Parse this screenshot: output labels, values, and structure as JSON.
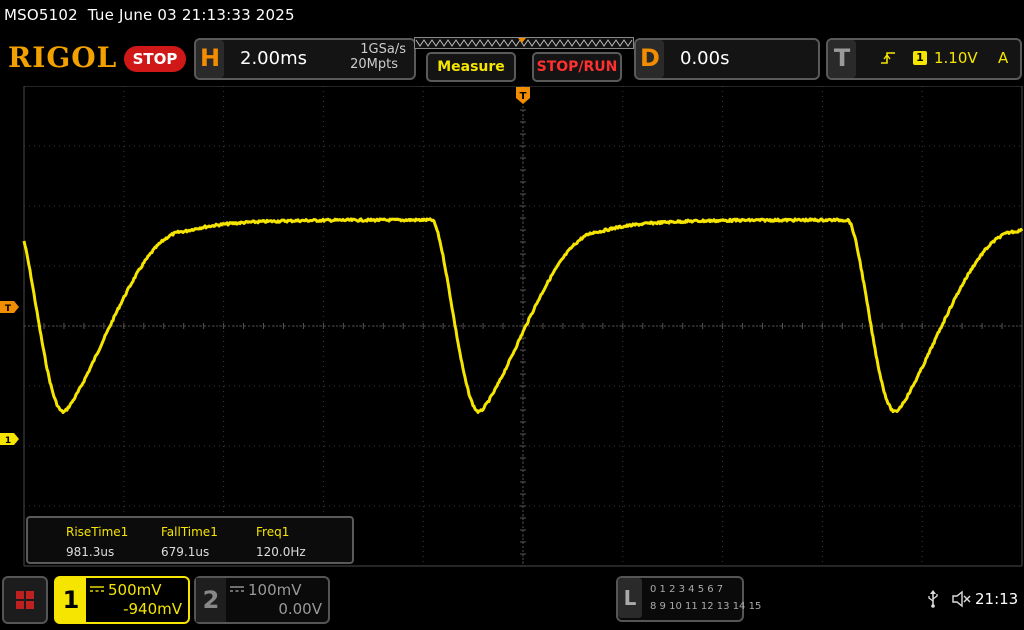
{
  "title": {
    "model": "MSO5102",
    "datetime": "Tue June 03 21:13:33 2025"
  },
  "header": {
    "brand": "RIGOL",
    "run_state": "STOP",
    "horizontal": {
      "letter": "H",
      "timebase": "2.00ms",
      "sample_rate": "1GSa/s",
      "memory_depth": "20Mpts"
    },
    "buttons": {
      "measure": "Measure",
      "stop_run": "STOP/RUN"
    },
    "delay": {
      "letter": "D",
      "value": "0.00s"
    },
    "trigger": {
      "letter": "T",
      "edge_icon": "rising-edge-icon",
      "source": "1",
      "level": "1.10V",
      "mode": "A"
    }
  },
  "markers": {
    "trigger_level": "T",
    "channel1_ground": "1",
    "trigger_position": "T"
  },
  "waveform": {
    "channel": "1",
    "shape": "periodic dips from a flat high level",
    "frequency_hz": 120.0,
    "color": "#f5e500"
  },
  "measurements": [
    {
      "label": "RiseTime1",
      "value": "981.3us"
    },
    {
      "label": "FallTime1",
      "value": "679.1us"
    },
    {
      "label": "Freq1",
      "value": "120.0Hz"
    }
  ],
  "channels": [
    {
      "number": "1",
      "scale": "500mV",
      "offset": "-940mV",
      "active": true,
      "coupling_icon": "dc-coupling-icon"
    },
    {
      "number": "2",
      "scale": "100mV",
      "offset": "0.00V",
      "active": false,
      "coupling_icon": "dc-coupling-icon"
    }
  ],
  "logic_analyzer": {
    "letter": "L",
    "row1": "0 1 2 3  4 5 6 7",
    "row2": "8 9 10 11 12 13 14 15"
  },
  "status": {
    "usb_icon": "usb-icon",
    "sound_icon": "speaker-muted-icon",
    "clock": "21:13"
  },
  "colors": {
    "channel1": "#f5e500",
    "accent": "#f28c00",
    "stop_red": "#d01818",
    "brand": "#f2a100"
  }
}
